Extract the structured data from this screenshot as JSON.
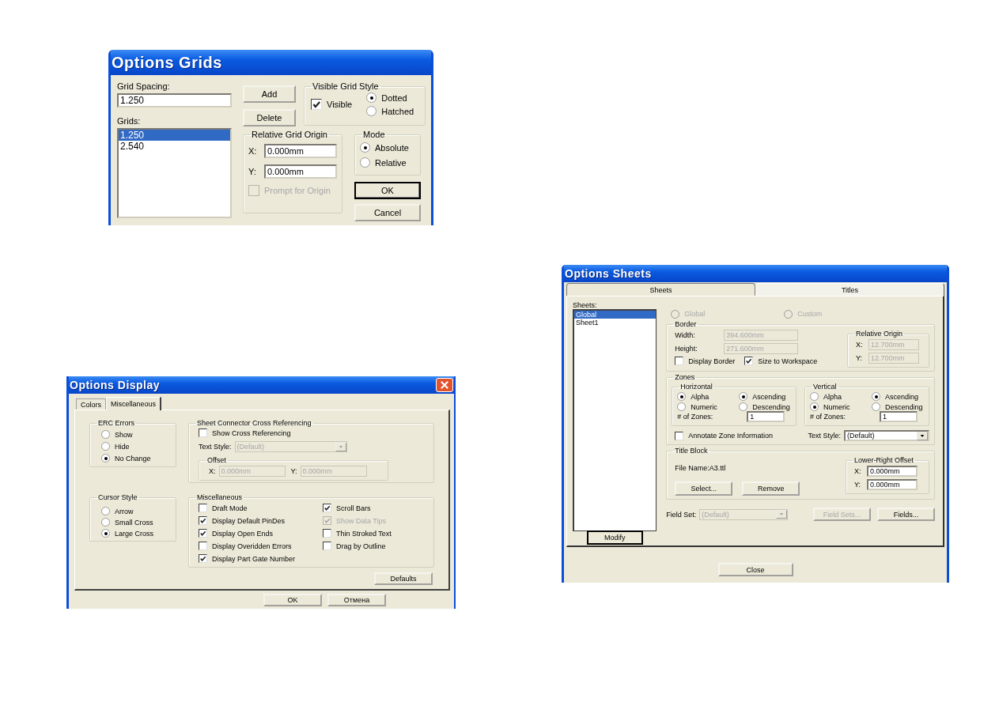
{
  "grids_dialog": {
    "title": "Options Grids",
    "grid_spacing": {
      "label": "Grid Spacing:",
      "value": "1.250"
    },
    "grids": {
      "label": "Grids:",
      "items": [
        {
          "text": "1.250",
          "selected": true
        },
        {
          "text": "2.540",
          "selected": false
        }
      ]
    },
    "list_buttons": [
      "Add",
      "Delete"
    ],
    "visible_grid_style": {
      "title": "Visible Grid Style",
      "visible": {
        "label": "Visible",
        "checked": true
      },
      "options": [
        {
          "label": "Dotted",
          "selected": true
        },
        {
          "label": "Hatched",
          "selected": false
        }
      ]
    },
    "relative_grid_origin": {
      "title": "Relative Grid Origin",
      "fields": [
        {
          "label": "X:",
          "value": "0.000mm"
        },
        {
          "label": "Y:",
          "value": "0.000mm"
        }
      ],
      "prompt": {
        "label": "Prompt for Origin",
        "checked": false,
        "disabled": true
      }
    },
    "mode": {
      "title": "Mode",
      "options": [
        {
          "label": "Absolute",
          "selected": true
        },
        {
          "label": "Relative",
          "selected": false
        }
      ]
    },
    "buttons": [
      {
        "label": "OK",
        "default": true
      },
      {
        "label": "Cancel",
        "default": false
      }
    ]
  },
  "display_dialog": {
    "title": "Options Display",
    "tabs": [
      {
        "label": "Colors",
        "selected": false
      },
      {
        "label": "Miscellaneous",
        "selected": true
      }
    ],
    "erc_errors": {
      "title": "ERC Errors",
      "options": [
        {
          "label": "Show",
          "selected": false
        },
        {
          "label": "Hide",
          "selected": false
        },
        {
          "label": "No Change",
          "selected": true
        }
      ]
    },
    "cursor_style": {
      "title": "Cursor Style",
      "options": [
        {
          "label": "Arrow",
          "selected": false
        },
        {
          "label": "Small Cross",
          "selected": false
        },
        {
          "label": "Large Cross",
          "selected": true
        }
      ]
    },
    "cross_referencing": {
      "title": "Sheet Connector Cross Referencing",
      "show": {
        "label": "Show Cross Referencing",
        "checked": false
      },
      "text_style": {
        "label": "Text Style:",
        "value": "(Default)",
        "disabled": true
      },
      "offset": {
        "title": "Offset",
        "fields": [
          {
            "label": "X:",
            "value": "0.000mm",
            "disabled": true
          },
          {
            "label": "Y:",
            "value": "0.000mm",
            "disabled": true
          }
        ]
      }
    },
    "miscellaneous": {
      "title": "Miscellaneous",
      "left": [
        {
          "label": "Draft Mode",
          "checked": false,
          "disabled": false
        },
        {
          "label": "Display Default PinDes",
          "checked": true,
          "disabled": false
        },
        {
          "label": "Display Open Ends",
          "checked": true,
          "disabled": false
        },
        {
          "label": "Display Overidden Errors",
          "checked": false,
          "disabled": false
        },
        {
          "label": "Display Part Gate Number",
          "checked": true,
          "disabled": false
        }
      ],
      "right": [
        {
          "label": "Scroll Bars",
          "checked": true,
          "disabled": false
        },
        {
          "label": "Show Data Tips",
          "checked": true,
          "disabled": true
        },
        {
          "label": "Thin Stroked Text",
          "checked": false,
          "disabled": false
        },
        {
          "label": "Drag by Outline",
          "checked": false,
          "disabled": false
        }
      ]
    },
    "defaults_button": "Defaults",
    "buttons": [
      "OK",
      "Отмена"
    ]
  },
  "sheets_dialog": {
    "title": "Options Sheets",
    "tabs": [
      {
        "label": "Sheets",
        "selected": false
      },
      {
        "label": "Titles",
        "selected": true
      }
    ],
    "sheets": {
      "label": "Sheets:",
      "items": [
        {
          "text": "Global",
          "selected": true
        },
        {
          "text": "Sheet1",
          "selected": false
        }
      ]
    },
    "modify_button": "Modify",
    "scope": [
      {
        "label": "Global",
        "selected": false,
        "disabled": true
      },
      {
        "label": "Custom",
        "selected": false,
        "disabled": true
      }
    ],
    "border": {
      "title": "Border",
      "fields": [
        {
          "label": "Width:",
          "value": "394.600mm",
          "disabled": true
        },
        {
          "label": "Height:",
          "value": "271.600mm",
          "disabled": true
        }
      ],
      "checks": [
        {
          "label": "Display Border",
          "checked": false,
          "disabled": false
        },
        {
          "label": "Size to Workspace",
          "checked": true,
          "disabled": false
        }
      ],
      "relative_origin": {
        "title": "Relative Origin",
        "fields": [
          {
            "label": "X:",
            "value": "12.700mm",
            "disabled": true
          },
          {
            "label": "Y:",
            "value": "12.700mm",
            "disabled": true
          }
        ]
      }
    },
    "zones": {
      "title": "Zones",
      "groups": [
        {
          "title": "Horizontal",
          "type": [
            {
              "label": "Alpha",
              "selected": true
            },
            {
              "label": "Numeric",
              "selected": false
            }
          ],
          "order": [
            {
              "label": "Ascending",
              "selected": true
            },
            {
              "label": "Descending",
              "selected": false
            }
          ],
          "count": {
            "label": "# of Zones:",
            "value": "1",
            "disabled": false
          }
        },
        {
          "title": "Vertical",
          "type": [
            {
              "label": "Alpha",
              "selected": false
            },
            {
              "label": "Numeric",
              "selected": true
            }
          ],
          "order": [
            {
              "label": "Ascending",
              "selected": true
            },
            {
              "label": "Descending",
              "selected": false
            }
          ],
          "count": {
            "label": "# of Zones:",
            "value": "1",
            "disabled": false
          }
        }
      ],
      "annotate": {
        "label": "Annotate Zone Information",
        "checked": false,
        "disabled": false
      },
      "text_style": {
        "label": "Text Style:",
        "value": "(Default)",
        "disabled": false
      }
    },
    "title_block": {
      "title": "Title Block",
      "file_name": "File Name:A3.ttl",
      "buttons": [
        "Select...",
        "Remove"
      ],
      "offset": {
        "title": "Lower-Right Offset",
        "fields": [
          {
            "label": "X:",
            "value": "0.000mm",
            "disabled": false
          },
          {
            "label": "Y:",
            "value": "0.000mm",
            "disabled": false
          }
        ]
      }
    },
    "field_set": {
      "label": "Field Set:",
      "value": "(Default)",
      "disabled": true
    },
    "field_buttons": [
      {
        "label": "Field Sets...",
        "disabled": true
      },
      {
        "label": "Fields...",
        "disabled": false
      }
    ],
    "close_button": "Close"
  }
}
